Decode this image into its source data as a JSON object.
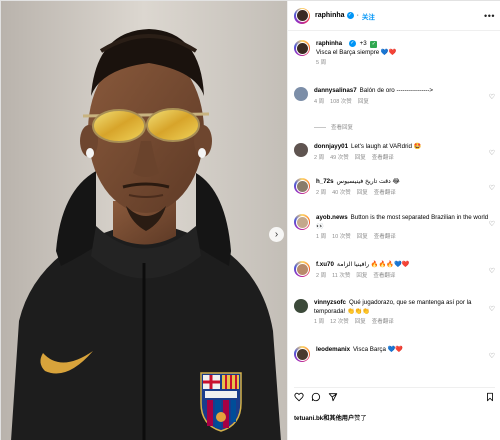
{
  "post": {
    "username": "raphinha",
    "follow_label": "关注",
    "more_icon": "more-horizontal-icon"
  },
  "caption": {
    "username": "raphinha",
    "tag": "+3",
    "text": "Visca el Barça siempre 💙❤️",
    "time": "5 周"
  },
  "comments": [
    {
      "user": "dannysalinas7",
      "text": "Balón de oro ---------------->",
      "time": "4 周",
      "likes": "108 次赞",
      "reply": "回复",
      "view_replies": "查看回复"
    },
    {
      "user": "donnjayy01",
      "text": "Let's laugh at VARdrid 🤩",
      "time": "2 周",
      "likes": "49 次赞",
      "reply": "回复",
      "translate": "查看翻译"
    },
    {
      "user": "h_72s",
      "text": "دقت تاريخ فينيسيوس 😂",
      "time": "2 周",
      "likes": "40 次赞",
      "reply": "回复",
      "translate": "查看翻译"
    },
    {
      "user": "ayob.news",
      "text": "Button is the most separated Brazilian in the world👀",
      "time": "1 周",
      "likes": "10 次赞",
      "reply": "回复",
      "translate": "查看翻译"
    },
    {
      "user": "f.xu70",
      "text": "رافينيا الزامة 🔥🔥🔥💙❤️",
      "time": "2 周",
      "likes": "11 次赞",
      "reply": "回复",
      "translate": "查看翻译"
    },
    {
      "user": "vinnyzsofc",
      "text": "Qué jugadorazo, que se mantenga así por la temporada! 👏👏👏",
      "time": "1 周",
      "likes": "12 次赞",
      "reply": "回复",
      "translate": "查看翻译"
    },
    {
      "user": "leodemanix",
      "text": "Visca Barça 💙❤️",
      "time": "",
      "likes": "",
      "reply": "",
      "translate": ""
    }
  ],
  "likes_line": {
    "user": "tetuani.bk和",
    "rest": "其他用户",
    "suffix": "赞了"
  },
  "photo": {
    "crest_text": "FCB"
  },
  "colors": {
    "accent": "#0095f6",
    "muted": "#8e8e8e",
    "hoodie": "#1b1b1b",
    "nike": "#d8a33b",
    "lens": "#e6c84a"
  }
}
